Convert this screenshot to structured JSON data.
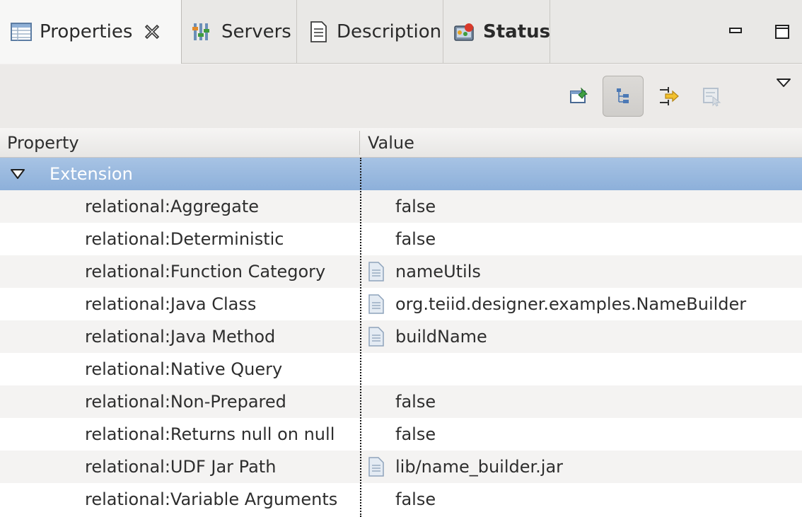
{
  "tabs": [
    {
      "label": "Properties",
      "icon": "properties-table-icon",
      "active": true
    },
    {
      "label": "Servers",
      "icon": "servers-icon"
    },
    {
      "label": "Description",
      "icon": "document-icon"
    },
    {
      "label": "Status",
      "icon": "status-icon"
    }
  ],
  "window_controls": {
    "minimize": "minimize-icon",
    "maximize": "maximize-icon"
  },
  "toolbar": {
    "buttons": [
      "pin-to-view-icon",
      "show-categories-icon",
      "show-advanced-icon",
      "restore-defaults-icon"
    ],
    "menu": "view-menu-icon"
  },
  "table": {
    "headers": {
      "property": "Property",
      "value": "Value"
    },
    "group_label": "Extension",
    "rows": [
      {
        "property": "relational:Aggregate",
        "value": "false",
        "icon": false
      },
      {
        "property": "relational:Deterministic",
        "value": "false",
        "icon": false
      },
      {
        "property": "relational:Function Category",
        "value": "nameUtils",
        "icon": true
      },
      {
        "property": "relational:Java Class",
        "value": "org.teiid.designer.examples.NameBuilder",
        "icon": true
      },
      {
        "property": "relational:Java Method",
        "value": "buildName",
        "icon": true
      },
      {
        "property": "relational:Native Query",
        "value": "",
        "icon": false
      },
      {
        "property": "relational:Non-Prepared",
        "value": "false",
        "icon": false
      },
      {
        "property": "relational:Returns null on null",
        "value": "false",
        "icon": false
      },
      {
        "property": "relational:UDF Jar Path",
        "value": "lib/name_builder.jar",
        "icon": true
      },
      {
        "property": "relational:Variable Arguments",
        "value": "false",
        "icon": false
      }
    ]
  },
  "colors": {
    "selection": "#98b8de",
    "accent": "#4a90d9"
  }
}
